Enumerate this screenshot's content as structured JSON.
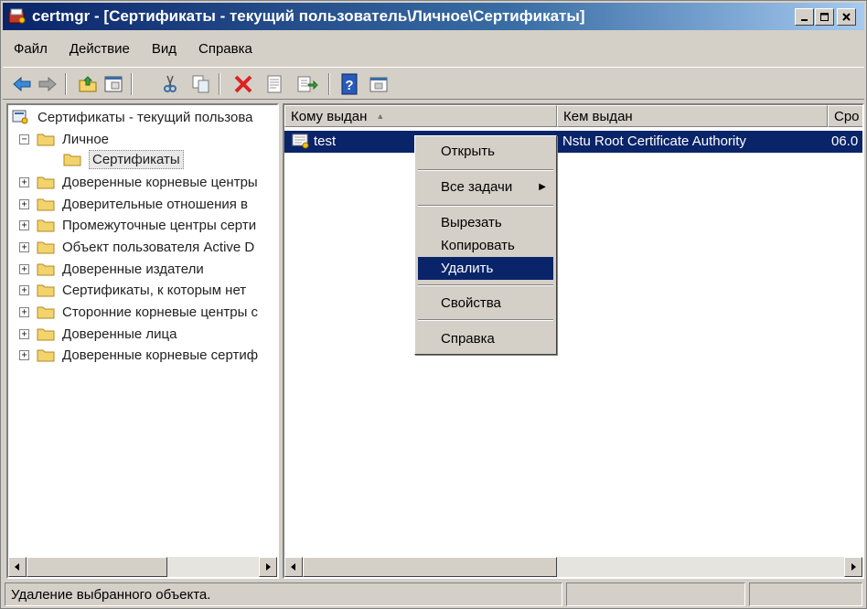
{
  "window": {
    "title": "certmgr - [Сертификаты - текущий пользователь\\Личное\\Сертификаты]",
    "controls": [
      "minimize",
      "maximize",
      "close"
    ]
  },
  "menubar": [
    "Файл",
    "Действие",
    "Вид",
    "Справка"
  ],
  "toolbar": {
    "icons": [
      "back-icon",
      "forward-icon",
      "up-folder-icon",
      "show-hide-tree-icon",
      "cut-icon",
      "copy-icon",
      "delete-icon",
      "properties-icon",
      "export-icon",
      "help-icon",
      "view-icon"
    ]
  },
  "tree": {
    "root": "Сертификаты - текущий пользова",
    "items": [
      {
        "label": "Личное",
        "expander": "−"
      },
      {
        "label": "Сертификаты",
        "expander": ""
      },
      {
        "label": "Доверенные корневые центры",
        "expander": "+"
      },
      {
        "label": "Доверительные отношения в",
        "expander": "+"
      },
      {
        "label": "Промежуточные центры серти",
        "expander": "+"
      },
      {
        "label": "Объект пользователя Active D",
        "expander": "+"
      },
      {
        "label": "Доверенные издатели",
        "expander": "+"
      },
      {
        "label": "Сертификаты, к которым нет",
        "expander": "+"
      },
      {
        "label": "Сторонние корневые центры с",
        "expander": "+"
      },
      {
        "label": "Доверенные лица",
        "expander": "+"
      },
      {
        "label": "Доверенные корневые сертиф",
        "expander": "+"
      }
    ]
  },
  "list": {
    "columns": [
      "Кому выдан",
      "Кем выдан",
      "Сро"
    ],
    "sort_indicator": "▲",
    "rows": [
      {
        "issued_to": "test",
        "issued_by": "Nstu Root Certificate Authority",
        "expires": "06.0"
      }
    ]
  },
  "context_menu": {
    "items": [
      "Открыть",
      "Все задачи",
      "Вырезать",
      "Копировать",
      "Удалить",
      "Свойства",
      "Справка"
    ],
    "highlighted": "Удалить"
  },
  "status": {
    "text": "Удаление выбранного объекта."
  },
  "colors": {
    "titlebar_start": "#0a246a",
    "selection": "#0a246a",
    "face": "#d4d0c8"
  }
}
